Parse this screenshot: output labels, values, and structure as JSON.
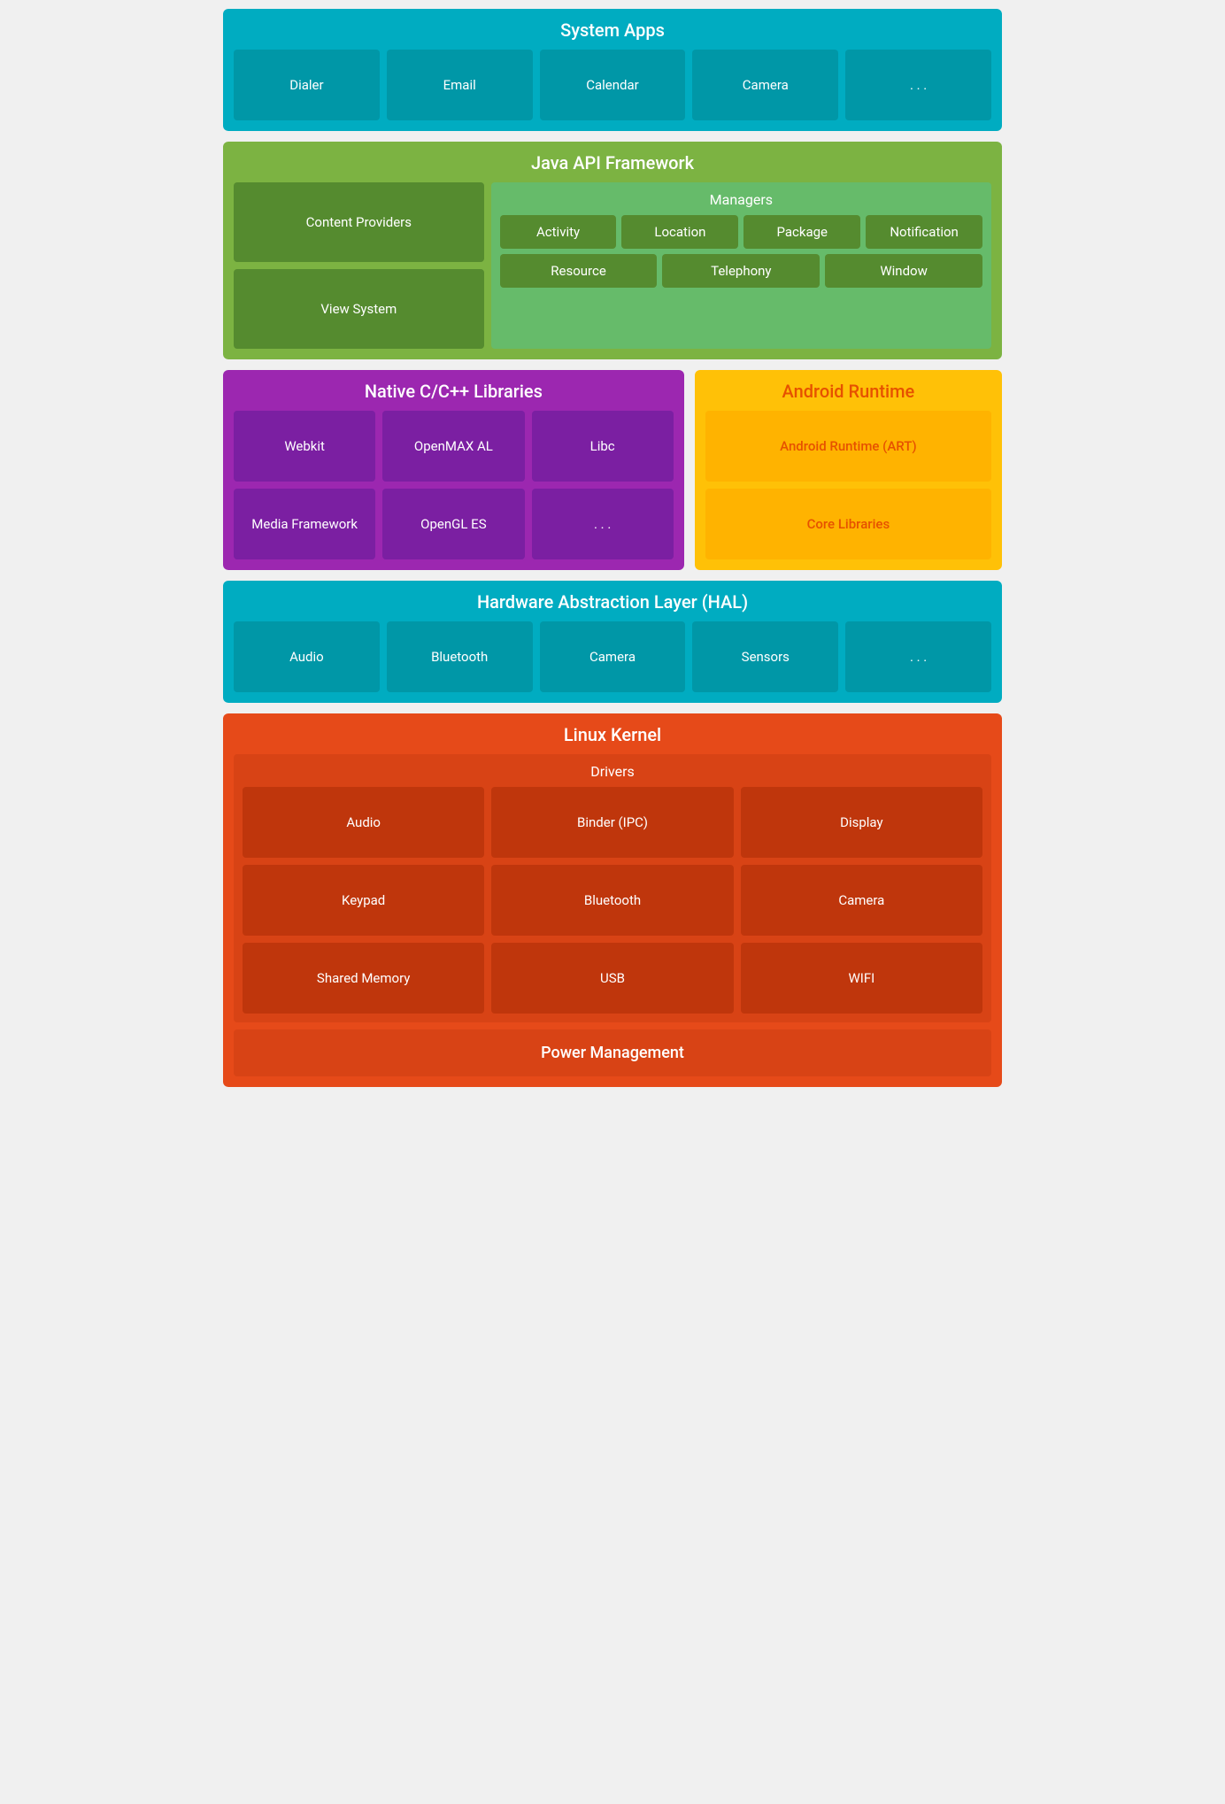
{
  "system_apps": {
    "title": "System Apps",
    "tiles": [
      "Dialer",
      "Email",
      "Calendar",
      "Camera",
      ". . ."
    ]
  },
  "java_api": {
    "title": "Java API Framework",
    "left_tiles": [
      "Content Providers",
      "View System"
    ],
    "managers": {
      "title": "Managers",
      "row1": [
        "Activity",
        "Location",
        "Package",
        "Notification"
      ],
      "row2": [
        "Resource",
        "Telephony",
        "Window"
      ]
    }
  },
  "native_libs": {
    "title": "Native C/C++ Libraries",
    "tiles": [
      "Webkit",
      "OpenMAX AL",
      "Libc",
      "Media Framework",
      "OpenGL ES",
      ". . ."
    ]
  },
  "android_runtime": {
    "title": "Android Runtime",
    "tiles": [
      "Android Runtime (ART)",
      "Core Libraries"
    ]
  },
  "hal": {
    "title": "Hardware Abstraction Layer (HAL)",
    "tiles": [
      "Audio",
      "Bluetooth",
      "Camera",
      "Sensors",
      ". . ."
    ]
  },
  "linux_kernel": {
    "title": "Linux Kernel",
    "drivers_title": "Drivers",
    "drivers": [
      "Audio",
      "Binder (IPC)",
      "Display",
      "Keypad",
      "Bluetooth",
      "Camera",
      "Shared Memory",
      "USB",
      "WIFI"
    ],
    "power_management": "Power Management"
  }
}
